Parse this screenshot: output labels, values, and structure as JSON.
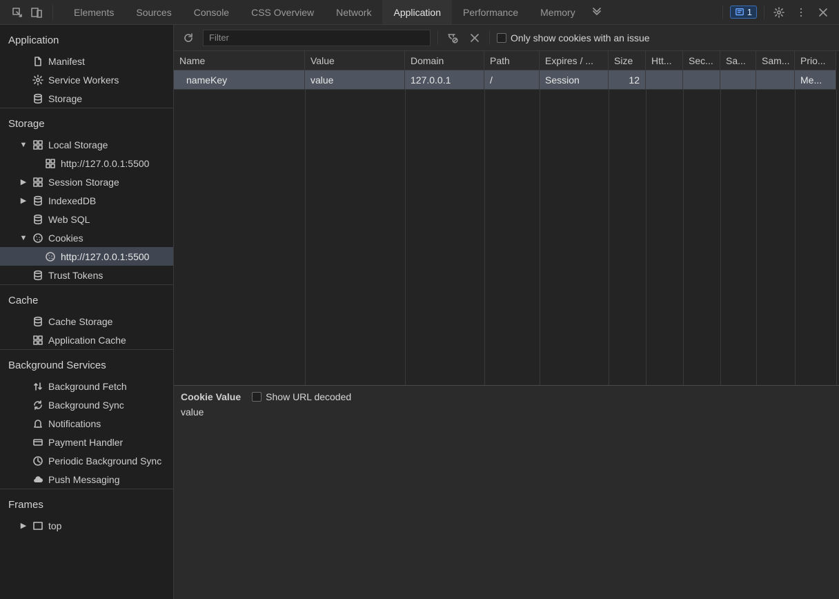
{
  "tabs": [
    "Elements",
    "Sources",
    "Console",
    "CSS Overview",
    "Network",
    "Application",
    "Performance",
    "Memory"
  ],
  "active_tab": "Application",
  "issue_count": "1",
  "toolbar": {
    "filter_placeholder": "Filter",
    "only_issues_label": "Only show cookies with an issue"
  },
  "sidebar": {
    "sections": [
      {
        "title": "Application",
        "items": [
          {
            "label": "Manifest",
            "icon": "file"
          },
          {
            "label": "Service Workers",
            "icon": "gear"
          },
          {
            "label": "Storage",
            "icon": "db"
          }
        ]
      },
      {
        "title": "Storage",
        "items": [
          {
            "label": "Local Storage",
            "icon": "grid",
            "arrow": "▼",
            "indent": 0
          },
          {
            "label": "http://127.0.0.1:5500",
            "icon": "grid",
            "indent": 2
          },
          {
            "label": "Session Storage",
            "icon": "grid",
            "arrow": "▶",
            "indent": 0
          },
          {
            "label": "IndexedDB",
            "icon": "db",
            "arrow": "▶",
            "indent": 0
          },
          {
            "label": "Web SQL",
            "icon": "db",
            "indent": 0
          },
          {
            "label": "Cookies",
            "icon": "cookie",
            "arrow": "▼",
            "indent": 0
          },
          {
            "label": "http://127.0.0.1:5500",
            "icon": "cookie",
            "indent": 2,
            "selected": true
          },
          {
            "label": "Trust Tokens",
            "icon": "db",
            "indent": 0
          }
        ]
      },
      {
        "title": "Cache",
        "items": [
          {
            "label": "Cache Storage",
            "icon": "db"
          },
          {
            "label": "Application Cache",
            "icon": "grid"
          }
        ]
      },
      {
        "title": "Background Services",
        "items": [
          {
            "label": "Background Fetch",
            "icon": "updown"
          },
          {
            "label": "Background Sync",
            "icon": "sync"
          },
          {
            "label": "Notifications",
            "icon": "bell"
          },
          {
            "label": "Payment Handler",
            "icon": "card"
          },
          {
            "label": "Periodic Background Sync",
            "icon": "clock"
          },
          {
            "label": "Push Messaging",
            "icon": "cloud"
          }
        ]
      },
      {
        "title": "Frames",
        "items": [
          {
            "label": "top",
            "icon": "frame",
            "arrow": "▶",
            "indent": 0
          }
        ]
      }
    ]
  },
  "table": {
    "columns": [
      "Name",
      "Value",
      "Domain",
      "Path",
      "Expires / ...",
      "Size",
      "Htt...",
      "Sec...",
      "Sa...",
      "Sam...",
      "Prio..."
    ],
    "rows": [
      {
        "cells": [
          "nameKey",
          "value",
          "127.0.0.1",
          "/",
          "Session",
          "12",
          "",
          "",
          "",
          "",
          "Me..."
        ],
        "selected": true
      }
    ]
  },
  "cookie_panel": {
    "title": "Cookie Value",
    "show_decoded_label": "Show URL decoded",
    "value": "value"
  }
}
